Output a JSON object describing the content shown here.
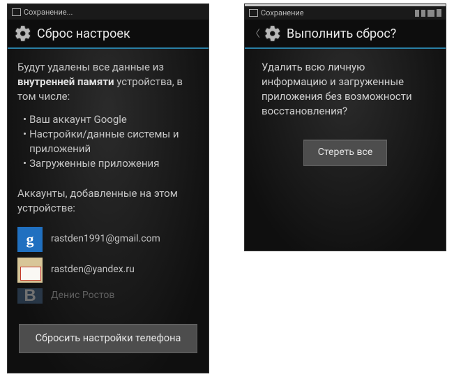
{
  "left": {
    "status_label": "Сохранение...",
    "title": "Сброс настроек",
    "desc_prefix": "Будут удалены все данные из",
    "desc_bold": "внутренней памяти",
    "desc_suffix": "устройства, в том числе:",
    "bullets": [
      "Ваш аккаунт Google",
      "Настройки/данные системы и приложений",
      "Загруженные приложения"
    ],
    "accounts_label": "Аккаунты, добавленные на этом устройстве:",
    "accounts": [
      {
        "email": "rastden1991@gmail.com",
        "icon": "google"
      },
      {
        "email": "rastden@yandex.ru",
        "icon": "mail"
      },
      {
        "email": "Денис Ростов",
        "icon": "vk"
      }
    ],
    "reset_button": "Сбросить настройки телефона"
  },
  "right": {
    "status_label": "Сохранение",
    "title": "Выполнить сброс?",
    "confirm_text": "Удалить всю личную информацию и загруженные приложения без возможности восстановления?",
    "erase_button": "Стереть все"
  }
}
